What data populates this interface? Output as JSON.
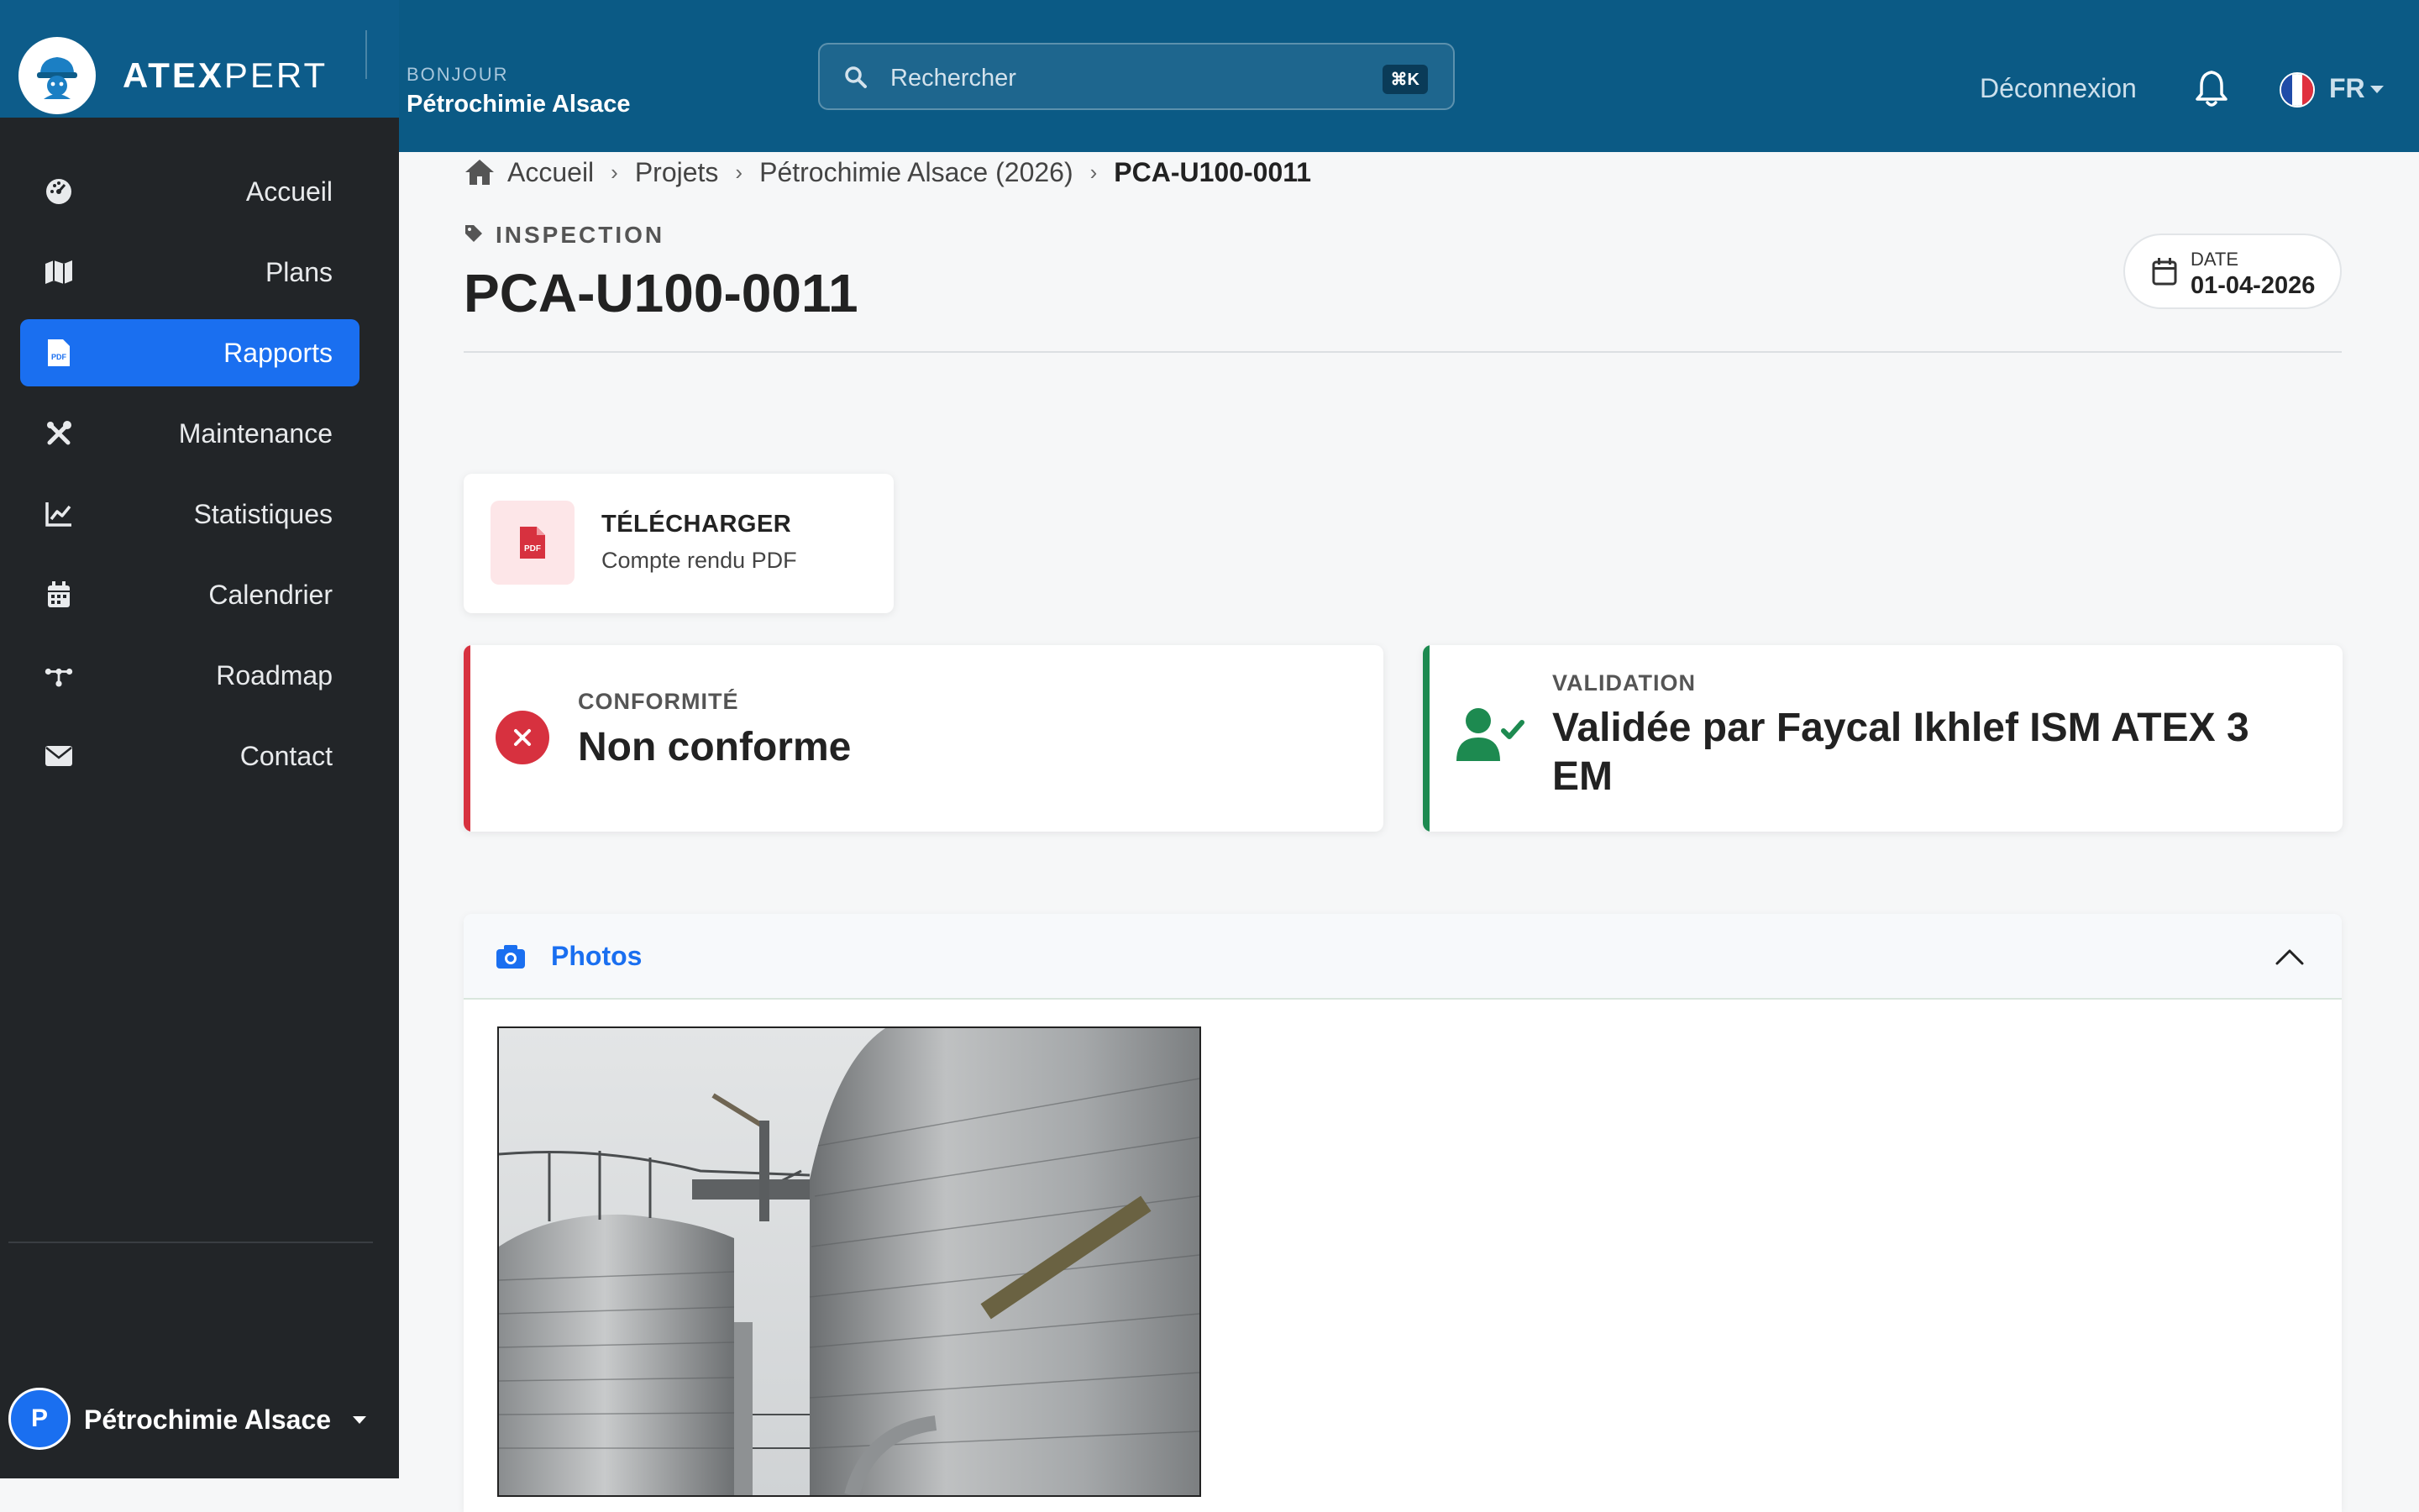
{
  "header": {
    "brand_bold": "ATEX",
    "brand_light": "PERT",
    "greeting_label": "BONJOUR",
    "greeting_name": "Pétrochimie Alsace",
    "search_placeholder": "Rechercher",
    "search_shortcut": "⌘K",
    "logout_label": "Déconnexion",
    "language": "FR"
  },
  "sidebar": {
    "items": [
      {
        "label": "Accueil",
        "icon": "gauge-icon",
        "active": false
      },
      {
        "label": "Plans",
        "icon": "map-icon",
        "active": false
      },
      {
        "label": "Rapports",
        "icon": "pdf-file-icon",
        "active": true
      },
      {
        "label": "Maintenance",
        "icon": "tools-icon",
        "active": false
      },
      {
        "label": "Statistiques",
        "icon": "chart-line-icon",
        "active": false
      },
      {
        "label": "Calendrier",
        "icon": "calendar-icon",
        "active": false
      },
      {
        "label": "Roadmap",
        "icon": "roadmap-icon",
        "active": false
      },
      {
        "label": "Contact",
        "icon": "envelope-icon",
        "active": false
      }
    ],
    "user_initial": "P",
    "user_name": "Pétrochimie Alsace"
  },
  "breadcrumb": {
    "items": [
      "Accueil",
      "Projets",
      "Pétrochimie Alsace (2026)"
    ],
    "current": "PCA-U100-0011"
  },
  "page": {
    "type_label": "INSPECTION",
    "title": "PCA-U100-0011",
    "date_label": "DATE",
    "date_value": "01-04-2026"
  },
  "download": {
    "title": "TÉLÉCHARGER",
    "subtitle": "Compte rendu PDF",
    "icon_text": "PDF"
  },
  "conformity": {
    "label": "CONFORMITÉ",
    "value": "Non conforme"
  },
  "validation": {
    "label": "VALIDATION",
    "value": "Validée par Faycal Ikhlef ISM ATEX 3 EM"
  },
  "photos": {
    "title": "Photos"
  },
  "colors": {
    "header_bg": "#0b5a85",
    "sidebar_bg": "#222528",
    "accent": "#1a6ff0",
    "danger": "#d7313f",
    "success": "#1d8a50"
  }
}
